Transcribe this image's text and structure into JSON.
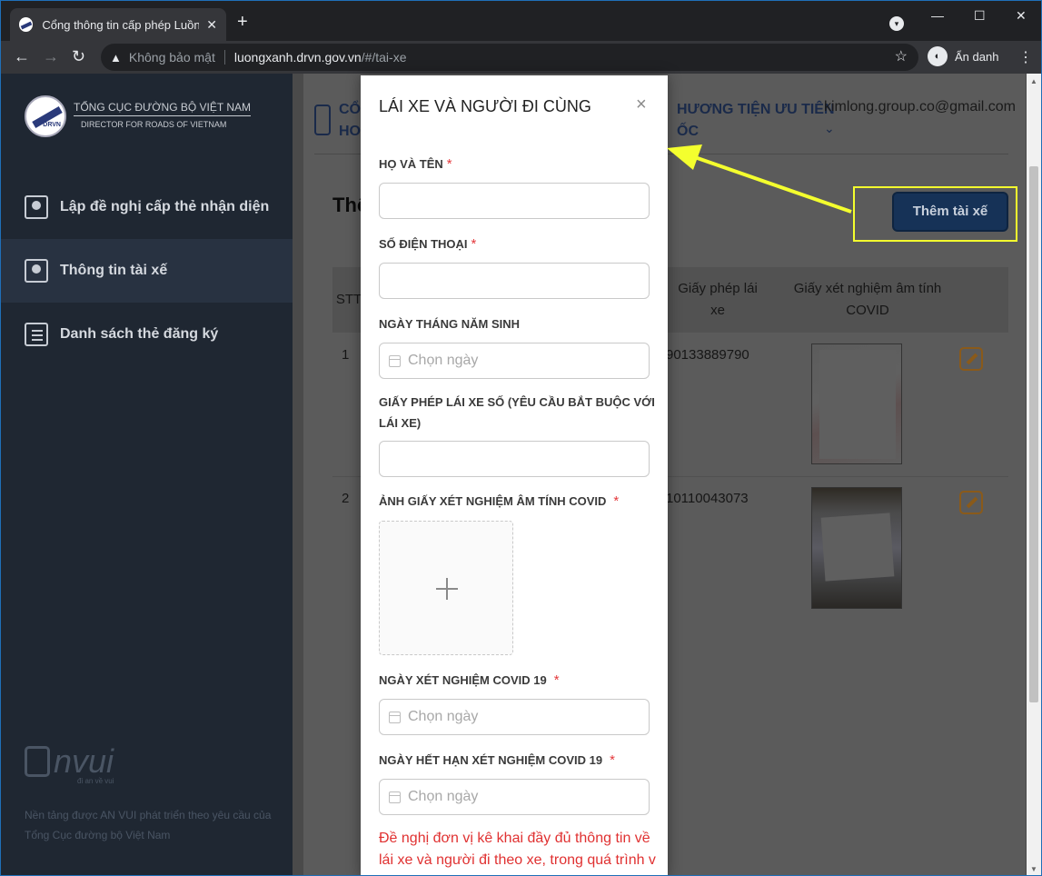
{
  "browser": {
    "tab_title": "Cổng thông tin cấp phép Luồng",
    "tab_close": "✕",
    "new_tab": "+",
    "address_warning": "Không bảo mật",
    "url_host": "luongxanh.drvn.gov.vn",
    "url_path": "/#/tai-xe",
    "profile_label": "Ẩn danh"
  },
  "sidebar": {
    "logo_line1": "TỔNG CỤC ĐƯỜNG BỘ VIỆT NAM",
    "logo_line2": "DIRECTOR FOR ROADS OF VIETNAM",
    "logo_abbr": "DRVN",
    "items": [
      {
        "label": "Lập đề nghị cấp thẻ nhận diện"
      },
      {
        "label": "Thông tin tài xế"
      },
      {
        "label": "Danh sách thẻ đăng ký"
      }
    ],
    "brand_word": "nvui",
    "brand_tag": "đi an về vui",
    "footer_text": "Nền tảng được AN VUI phát triển theo yêu cầu của Tổng Cục đường bộ Việt Nam"
  },
  "main": {
    "topnav_left_1": "CỔNG",
    "topnav_left_2": "HOẠT",
    "topnav_right_1": "HƯƠNG TIỆN ƯU TIÊN",
    "topnav_right_2": "ỐC",
    "user_email": "kimlong.group.co@gmail.com",
    "page_heading": "Thô",
    "add_driver_button": "Thêm tài xế",
    "table": {
      "headers": {
        "stt": "STT",
        "license_1": "Giấy phép lái",
        "license_2": "xe",
        "covid_1": "Giấy xét nghiệm âm tính",
        "covid_2": "COVID"
      },
      "rows": [
        {
          "stt": "1",
          "license": "90133889790"
        },
        {
          "stt": "2",
          "license": "10110043073"
        }
      ]
    }
  },
  "modal": {
    "title": "LÁI XE VÀ NGƯỜI ĐI CÙNG",
    "close": "×",
    "fields": {
      "full_name": "HỌ VÀ TÊN",
      "phone": "SỐ ĐIỆN THOẠI",
      "birth_date": "NGÀY THÁNG NĂM SINH",
      "license": "GIẤY PHÉP LÁI XE SỐ (YÊU CẦU BẮT BUỘC VỚI LÁI XE)",
      "covid_photo": "ẢNH GIẤY XÉT NGHIỆM ÂM TÍNH COVID",
      "covid_test_date": "NGÀY XÉT NGHIỆM COVID 19",
      "covid_expiry_date": "NGÀY HẾT HẠN XÉT NGHIỆM COVID 19"
    },
    "required_mark": "*",
    "date_placeholder": "Chọn ngày",
    "notice": "Đề nghị đơn vị kê khai đầy đủ thông tin về lái xe và người đi theo xe, trong quá trình v"
  },
  "colors": {
    "sidebar_bg": "#1f2732",
    "annotation": "#f4ff2e",
    "required": "#e4393c",
    "button_bg": "#163257"
  }
}
